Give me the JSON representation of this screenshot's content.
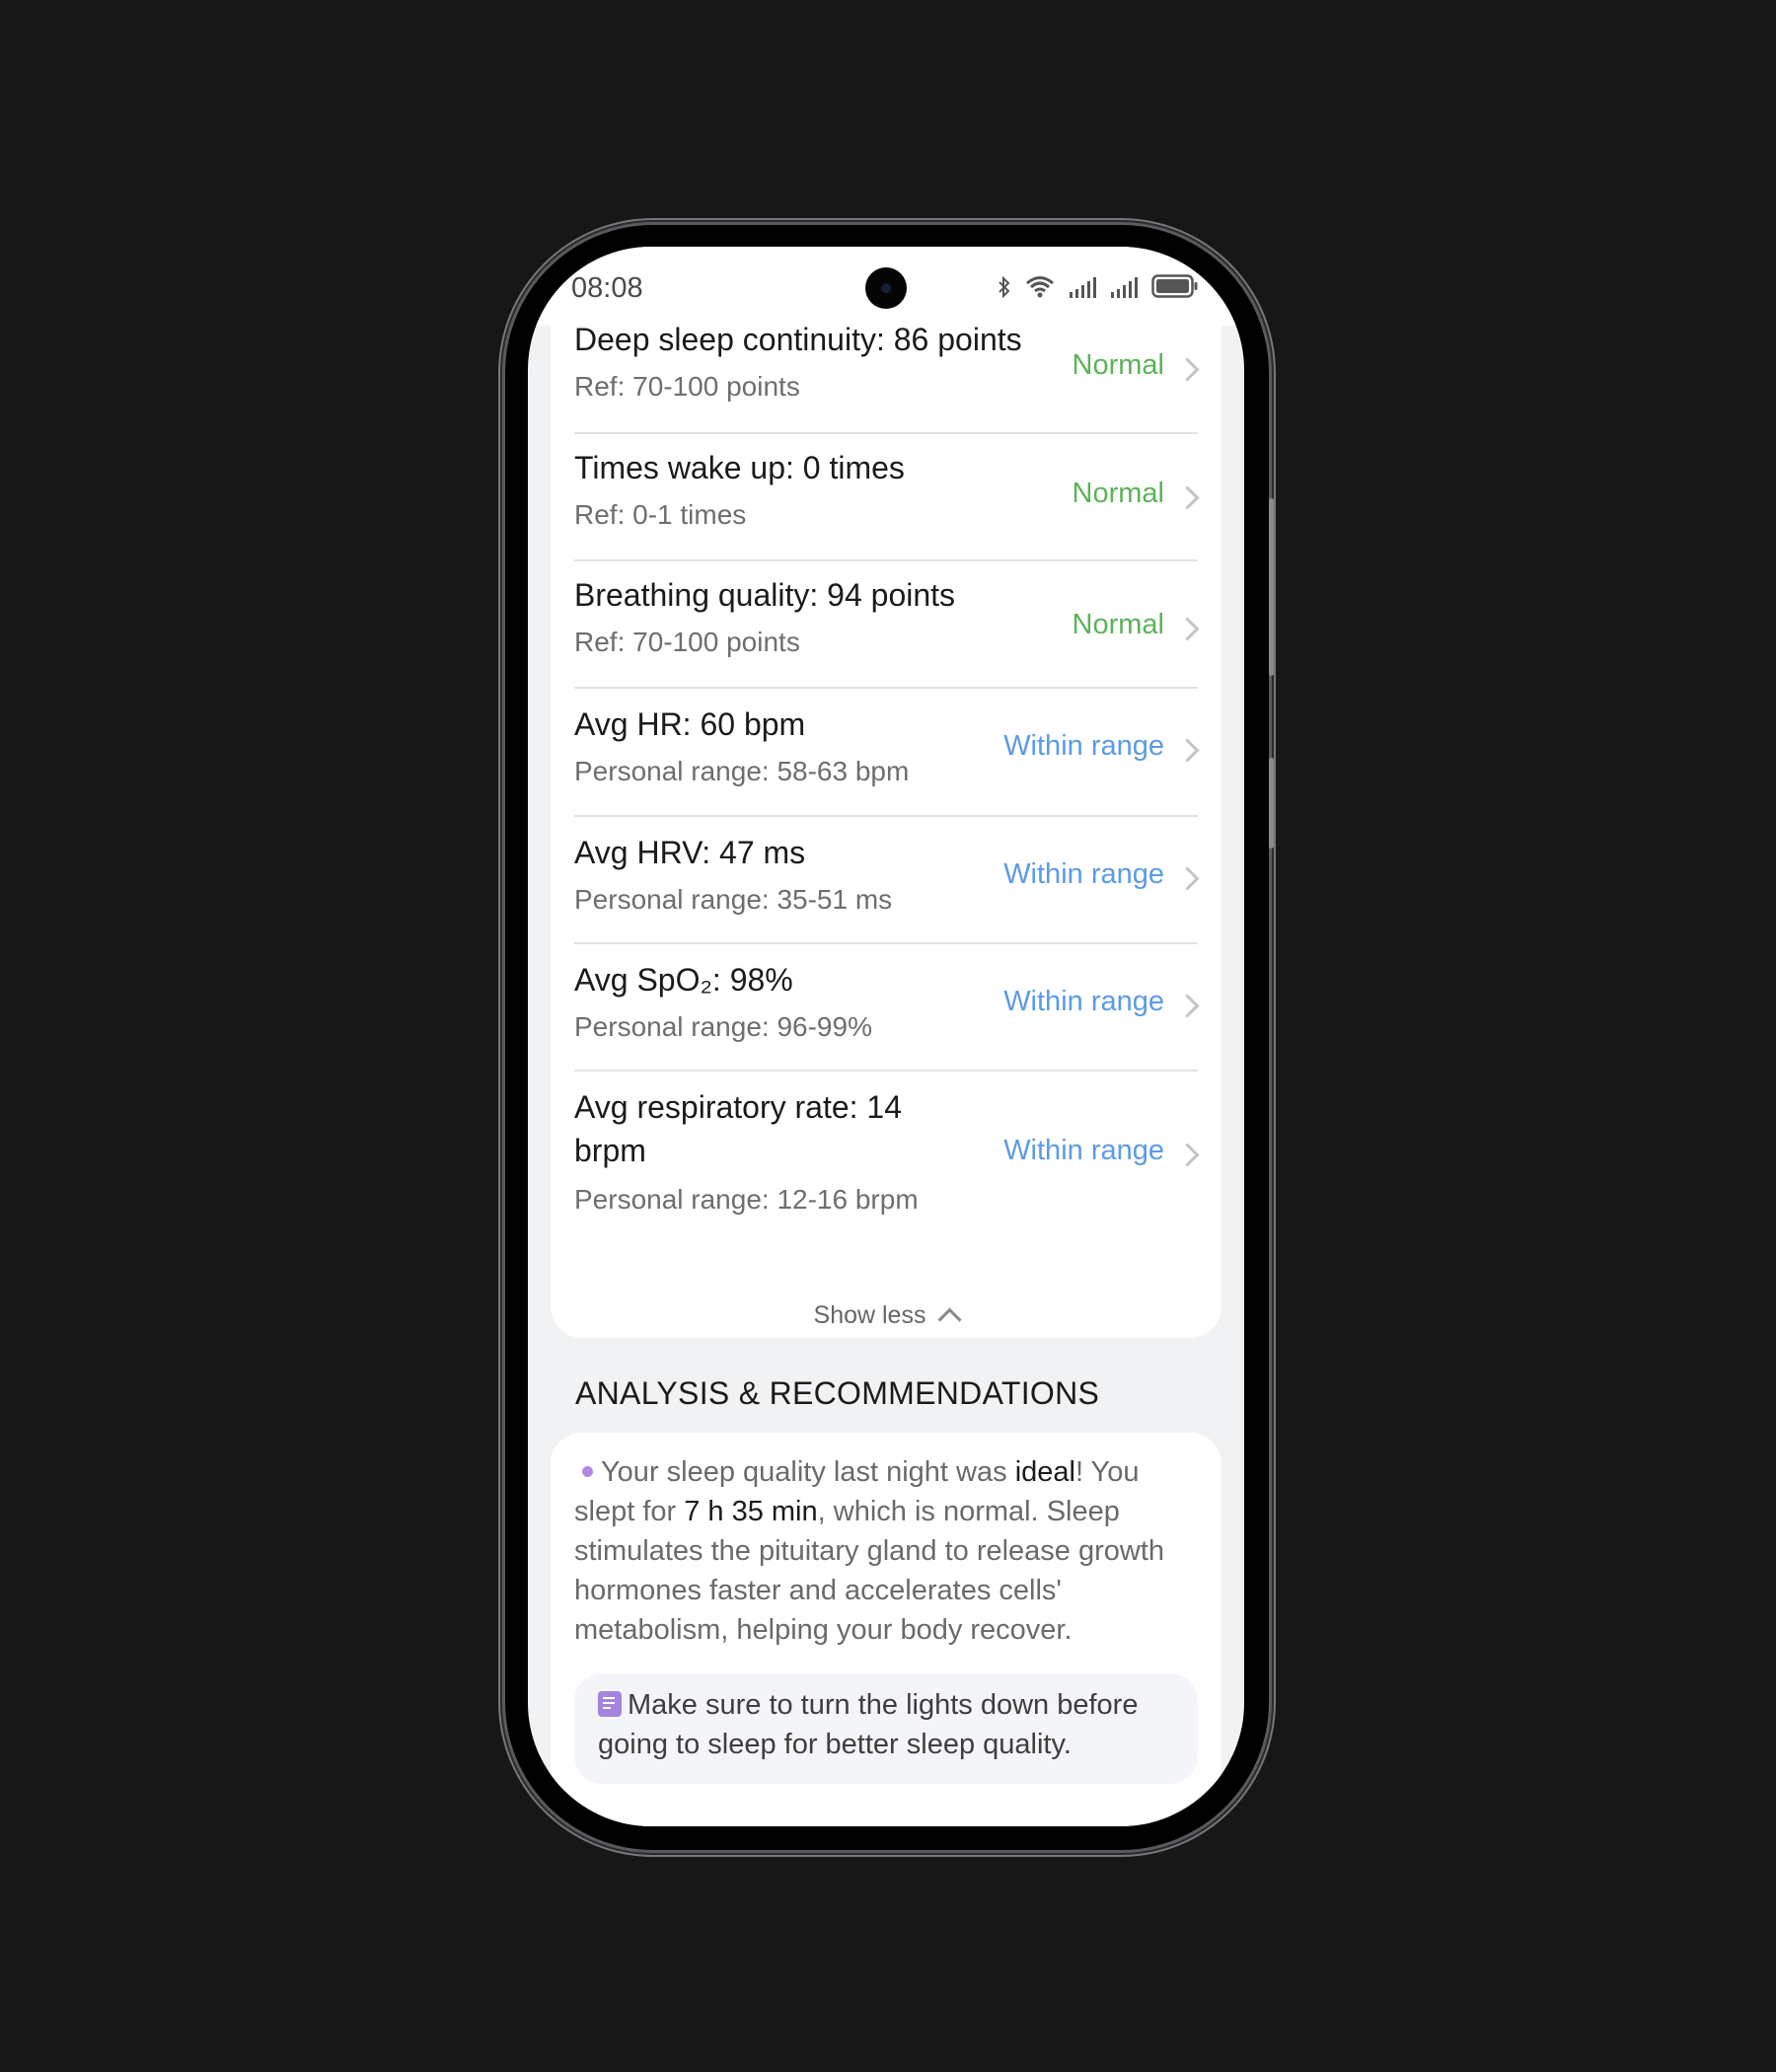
{
  "status_bar": {
    "time": "08:08",
    "icons": [
      "bluetooth-icon",
      "wifi-icon",
      "signal-icon",
      "signal-icon",
      "battery-icon"
    ]
  },
  "metrics": [
    {
      "title": "Deep sleep continuity: 86 points",
      "sub": "Ref: 70-100 points",
      "status": "Normal",
      "status_color": "#5db25b"
    },
    {
      "title": "Times wake up: 0 times",
      "sub": "Ref: 0-1 times",
      "status": "Normal",
      "status_color": "#5db25b"
    },
    {
      "title": "Breathing quality: 94 points",
      "sub": "Ref: 70-100 points",
      "status": "Normal",
      "status_color": "#5db25b"
    },
    {
      "title": "Avg HR: 60 bpm",
      "sub": "Personal range: 58-63 bpm",
      "status": "Within range",
      "status_color": "#5b9be6"
    },
    {
      "title": "Avg HRV: 47 ms",
      "sub": "Personal range: 35-51 ms",
      "status": "Within range",
      "status_color": "#5b9be6"
    },
    {
      "title": "Avg SpO₂: 98%",
      "sub": "Personal range: 96-99%",
      "status": "Within range",
      "status_color": "#5b9be6"
    },
    {
      "title": "Avg respiratory rate: 14 brpm",
      "sub": "Personal range: 12-16 brpm",
      "status": "Within range",
      "status_color": "#5b9be6"
    }
  ],
  "show_less_label": "Show less",
  "analysis": {
    "section_title": "ANALYSIS & RECOMMENDATIONS",
    "p1_pre": "Your sleep quality last night was ",
    "p1_bold1": "ideal",
    "p1_mid": "!   You slept for ",
    "p1_bold2": "7 h 35 min",
    "p1_post": ", which is normal. Sleep stimulates the pituitary gland to release growth hormones faster and accelerates cells' metabolism, helping your body recover.",
    "tip": "Make sure to turn the lights down before going to sleep for better sleep quality."
  }
}
